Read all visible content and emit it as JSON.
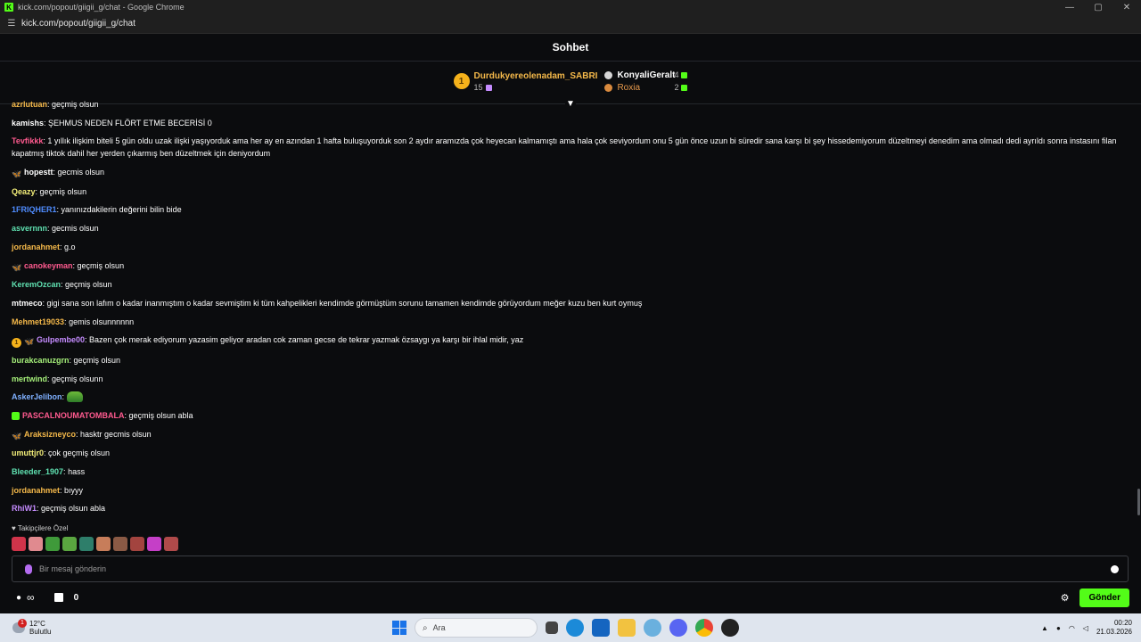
{
  "window": {
    "title": "kick.com/popout/giigii_g/chat - Google Chrome",
    "url": "kick.com/popout/giigii_g/chat",
    "controls": [
      "—",
      "▢",
      "✕"
    ]
  },
  "chat": {
    "title": "Sohbet",
    "leaderboard": {
      "first": {
        "rank": "1",
        "name": "Durdukyereolenadam_SABRI",
        "count": "15"
      },
      "others": [
        {
          "name": "KonyaliGeralt",
          "count": "4"
        },
        {
          "name": "Roxia",
          "count": "2"
        }
      ]
    },
    "messages": [
      {
        "user": "azrlutuan",
        "color": "#f5b94a",
        "text": "geçmiş olsun",
        "badges": []
      },
      {
        "user": "kamishs",
        "color": "#ffffff",
        "text": "ŞEHMUS NEDEN FLÖRT ETME BECERİSİ 0",
        "badges": []
      },
      {
        "user": "Tevfikkk",
        "color": "#ff5a8f",
        "text": "1 yıllık ilişkim biteli 5 gün oldu uzak ilişki yaşıyorduk ama her ay en azından 1 hafta buluşuyorduk son 2 aydır aramızda çok heyecan kalmamıştı ama hala çok seviyordum onu 5 gün önce uzun bi süredir sana karşı bi şey hissedemiyorum düzeltmeyi denedim ama olmadı dedi ayrıldı sonra instasını filan kapatmış tiktok dahil her yerden çıkarmış ben düzeltmek için deniyordum",
        "badges": []
      },
      {
        "user": "hopestt",
        "color": "#ffffff",
        "text": "gecmis olsun",
        "badges": [
          "butterfly"
        ]
      },
      {
        "user": "Qeazy",
        "color": "#f5f07a",
        "text": "geçmiş olsun",
        "badges": []
      },
      {
        "user": "1FRIQHER1",
        "color": "#4f8cff",
        "text": "yanınızdakilerin değerini bilin bide",
        "badges": []
      },
      {
        "user": "asvernnn",
        "color": "#5fe0b0",
        "text": "gecmis olsun",
        "badges": []
      },
      {
        "user": "jordanahmet",
        "color": "#f5b94a",
        "text": "g.o",
        "badges": []
      },
      {
        "user": "canokeyman",
        "color": "#ff5a8f",
        "text": "geçmiş olsun",
        "badges": [
          "butterfly"
        ]
      },
      {
        "user": "KeremOzcan",
        "color": "#5fe0b0",
        "text": "geçmiş olsun",
        "badges": []
      },
      {
        "user": "mtmeco",
        "color": "#ffffff",
        "text": "gigi sana son lafım o kadar inanmıştım o kadar sevmiştim ki tüm kahpelikleri kendimde görmüştüm sorunu tamamen kendimde görüyordum meğer kuzu ben kurt oymuş",
        "badges": []
      },
      {
        "user": "Mehmet19033",
        "color": "#f5b94a",
        "text": "gemis olsunnnnnn",
        "badges": []
      },
      {
        "user": "Gulpembe00",
        "color": "#c58cff",
        "text": "Bazen çok merak ediyorum yazasim geliyor aradan cok zaman gecse de tekrar yazmak özsaygı ya karşı bir ihlal midir, yaz",
        "badges": [
          "coin",
          "butterfly"
        ]
      },
      {
        "user": "burakcanuzgrn",
        "color": "#a6f07a",
        "text": "geçmiş olsun",
        "badges": []
      },
      {
        "user": "mertwind",
        "color": "#a6f07a",
        "text": "geçmiş olsunn",
        "badges": []
      },
      {
        "user": "AskerJelibon",
        "color": "#7fb0ff",
        "text": "",
        "badges": [],
        "emote": "frog"
      },
      {
        "user": "PASCALNOUMATOMBALA",
        "color": "#ff5a8f",
        "text": "geçmiş olsun abla",
        "badges": [
          "gift"
        ]
      },
      {
        "user": "Araksizneyco",
        "color": "#f5b94a",
        "text": "hasktr gecmis olsun",
        "badges": [
          "butterfly"
        ]
      },
      {
        "user": "umuttjr0",
        "color": "#f5f07a",
        "text": "çok geçmiş olsun",
        "badges": []
      },
      {
        "user": "Bleeder_1907",
        "color": "#5fe0b0",
        "text": "hass",
        "badges": []
      },
      {
        "user": "jordanahmet",
        "color": "#f5b94a",
        "text": "bıyyy",
        "badges": []
      },
      {
        "user": "RhiW1",
        "color": "#c58cff",
        "text": "geçmiş olsun abla",
        "badges": []
      }
    ],
    "follower_emotes_label": "Takipçilere Özel",
    "input_placeholder": "Bir mesaj gönderin",
    "footer": {
      "points": "0",
      "send_label": "Gönder"
    }
  },
  "taskbar": {
    "weather_temp": "12°C",
    "weather_desc": "Bulutlu",
    "weather_badge": "1",
    "search_placeholder": "Ara",
    "time": "00:20",
    "date": "21.03.2026"
  },
  "colors": {
    "accent": "#53fc18",
    "background": "#0b0c0e"
  }
}
